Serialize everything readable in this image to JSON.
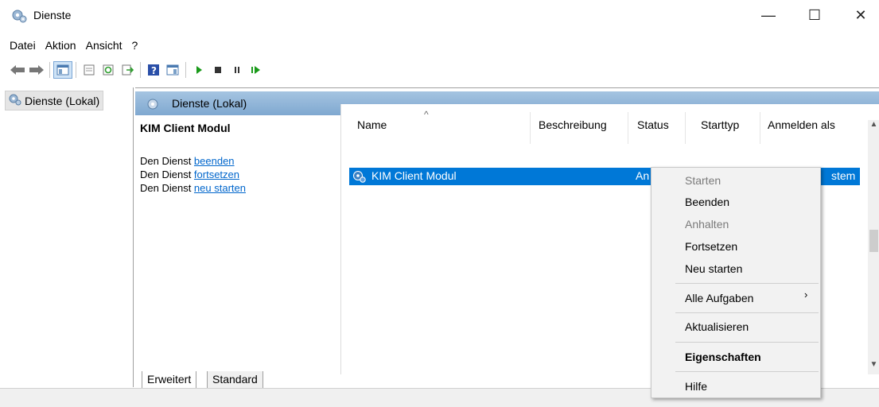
{
  "window": {
    "title": "Dienste",
    "icon": "gears-icon",
    "controls": {
      "minimize": "—",
      "maximize": "☐",
      "close": "✕"
    }
  },
  "menubar": [
    "Datei",
    "Aktion",
    "Ansicht",
    "?"
  ],
  "toolbar": {
    "icons": [
      "back-arrow-icon",
      "forward-arrow-icon",
      "console-tree-icon",
      "properties-icon",
      "refresh-icon",
      "export-list-icon",
      "help-icon",
      "show-hide-action-pane-icon",
      "start-service-icon",
      "stop-service-icon",
      "pause-service-icon",
      "resume-service-icon"
    ]
  },
  "tree": {
    "item": "Dienste (Lokal)"
  },
  "panel": {
    "header": "Dienste (Lokal)"
  },
  "description": {
    "service_name": "KIM Client Modul",
    "line1_prefix": "Den Dienst ",
    "line1_link": "beenden",
    "line2_prefix": "Den Dienst ",
    "line2_link": "fortsetzen",
    "line3_prefix": "Den Dienst ",
    "line3_link": "neu starten"
  },
  "list": {
    "columns": [
      "Name",
      "Beschreibung",
      "Status",
      "Starttyp",
      "Anmelden als"
    ],
    "selected_row": {
      "name": "KIM Client Modul",
      "status": "An",
      "logon": "stem"
    }
  },
  "tabs": [
    "Erweitert",
    "Standard"
  ],
  "context_menu": {
    "items": [
      {
        "label": "Starten",
        "enabled": false
      },
      {
        "label": "Beenden",
        "enabled": true
      },
      {
        "label": "Anhalten",
        "enabled": false
      },
      {
        "label": "Fortsetzen",
        "enabled": true
      },
      {
        "label": "Neu starten",
        "enabled": true
      },
      {
        "label": "Alle Aufgaben",
        "enabled": true,
        "submenu_arrow": "›"
      },
      {
        "label": "Aktualisieren",
        "enabled": true
      },
      {
        "label": "Eigenschaften",
        "enabled": true
      },
      {
        "label": "Hilfe",
        "enabled": true
      }
    ]
  },
  "colors": {
    "selection": "#0078d7",
    "header_blue": "#8fb3d9",
    "link": "#0066cc"
  }
}
